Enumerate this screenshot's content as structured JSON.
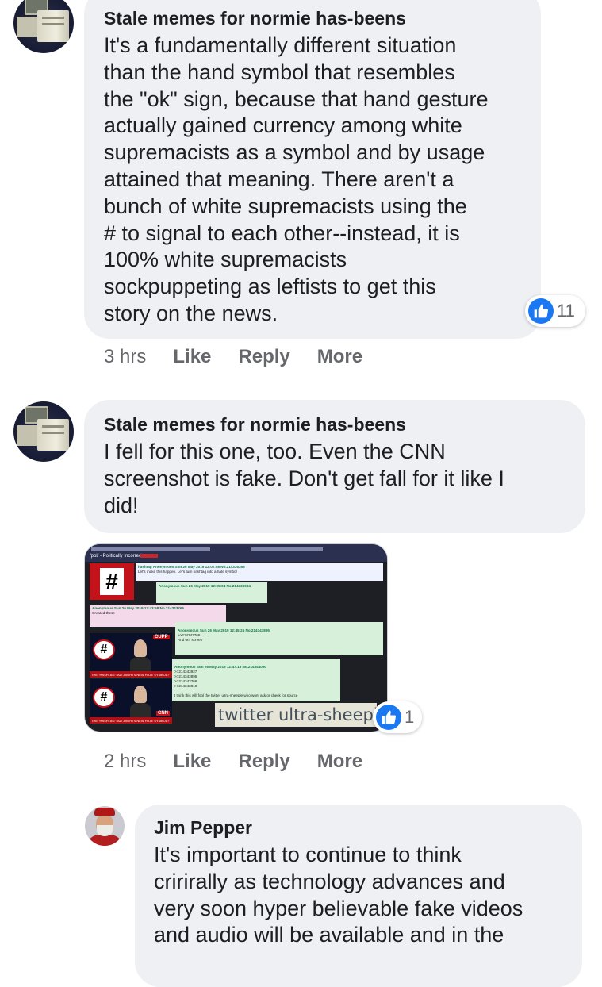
{
  "comments": [
    {
      "author": "Stale memes for normie has-beens",
      "text": "It's a fundamentally different situation\nthan the hand symbol that resembles\nthe \"ok\" sign, because that hand gesture\nactually gained currency among white\nsupremacists as a symbol and by usage\nattained that meaning. There aren't a\nbunch of white supremacists using the\n# to signal to each other--instead, it is\n100% white supremacists\nsockpuppeting as leftists to get this\nstory on the news.",
      "reaction_count": "11",
      "time": "3 hrs",
      "actions": [
        "Like",
        "Reply",
        "More"
      ]
    },
    {
      "author": "Stale memes for normie has-beens",
      "text": "I fell for this one, too. Even the CNN\nscreenshot is fake. Don't get fall for it like I\ndid!",
      "reaction_count": "1",
      "time": "2 hrs",
      "actions": [
        "Like",
        "Reply",
        "More"
      ],
      "attachment": {
        "board_title": "/pol/ - Politically Incorrect",
        "hash_symbol": "#",
        "op_header": "hashtag Anonymous Sun 26 May 2019 12:02:58 No.214335355",
        "op_body": "Let's make this happen. Let's turn hashtag into a hate symbol",
        "post1_header": "Anonymous Sun 26 May 2019 12:05:04 No.214336084",
        "post2_header": "Anonymous Sun 26 May 2019 12:43:58 No.214343766",
        "post2_body": "Created these",
        "post3_header": "Anonymous Sun 26 May 2019 12:45:25 No.214343895",
        "post3_body": ">>214343766\nAnd on \"screen\"",
        "post4_header": "Anonymous Sun 26 May 2019 12:47:13 No.214344090",
        "post4_body": ">>214343927\n>>214343895\n>>214343766\n>>214343819\n\nI think this will fool the twitter ultra-sheeple who wont ask or check for source",
        "tv_ticker": "THE \"HASHTAG\": ALT-RIGHTS NEW HATE SYMBOL?",
        "tv_logo": "CNN",
        "tv_logo2": "CUPP",
        "caption": "twitter ultra-sheeple"
      }
    },
    {
      "author": "Jim Pepper",
      "text": "It's important to continue to think\ncririrally as technology advances and\nvery soon hyper believable fake videos\nand audio will be available and in the"
    }
  ],
  "colors": {
    "bubble": "#eff0f4",
    "like_blue": "#1a78f2",
    "meta_gray": "#65676b"
  }
}
